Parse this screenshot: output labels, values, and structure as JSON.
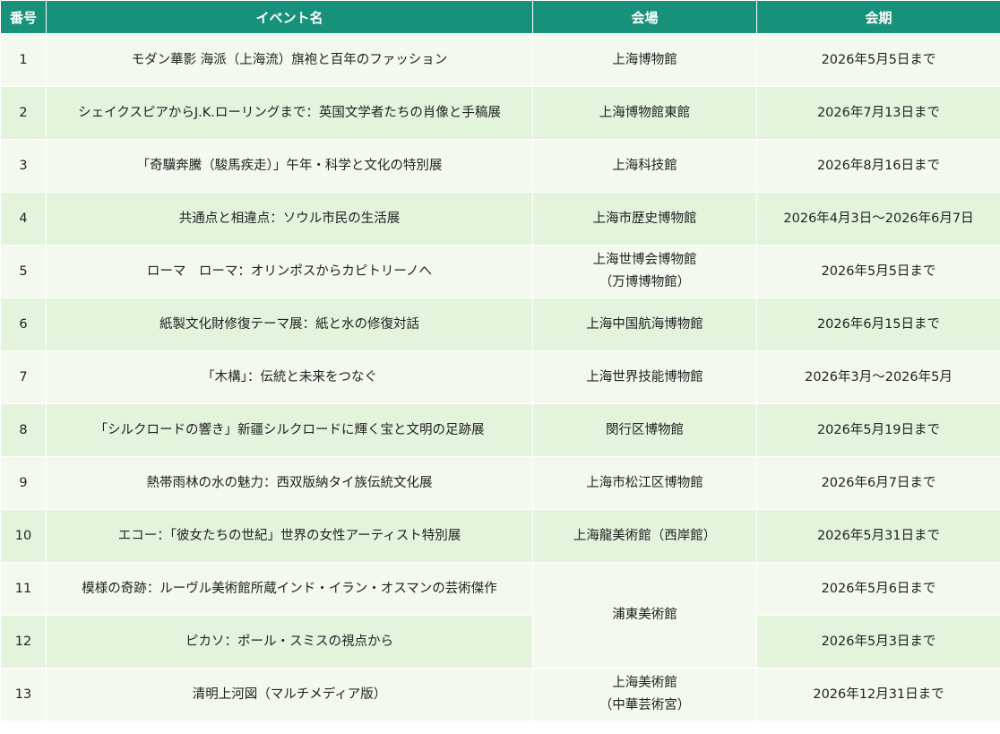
{
  "header": {
    "number": "番号",
    "event": "イベント名",
    "venue": "会場",
    "period": "会期"
  },
  "rows": [
    {
      "no": "1",
      "event": "モダン華影 海派（上海流）旗袍と百年のファッション",
      "venue_lines": [
        "上海博物館"
      ],
      "period": "2026年5月5日まで"
    },
    {
      "no": "2",
      "event": "シェイクスピアからJ.K.ローリングまで：英国文学者たちの肖像と手稿展",
      "venue_lines": [
        "上海博物館東館"
      ],
      "period": "2026年7月13日まで"
    },
    {
      "no": "3",
      "event": "「奇驥奔騰（駿馬疾走）」午年・科学と文化の特別展",
      "venue_lines": [
        "上海科技館"
      ],
      "period": "2026年8月16日まで"
    },
    {
      "no": "4",
      "event": "共通点と相違点：ソウル市民の生活展",
      "venue_lines": [
        "上海市歴史博物館"
      ],
      "period": "2026年4月3日～2026年6月7日"
    },
    {
      "no": "5",
      "event": "ローマ　ローマ：オリンポスからカピトリーノへ",
      "venue_lines": [
        "上海世博会博物館",
        "（万博博物館）"
      ],
      "period": "2026年5月5日まで"
    },
    {
      "no": "6",
      "event": "紙製文化財修復テーマ展：紙と水の修復対話",
      "venue_lines": [
        "上海中国航海博物館"
      ],
      "period": "2026年6月15日まで"
    },
    {
      "no": "7",
      "event": "「木構」：伝統と未来をつなぐ",
      "venue_lines": [
        "上海世界技能博物館"
      ],
      "period": "2026年3月～2026年5月"
    },
    {
      "no": "8",
      "event": "「シルクロードの響き」新疆シルクロードに輝く宝と文明の足跡展",
      "venue_lines": [
        "閔行区博物館"
      ],
      "period": "2026年5月19日まで"
    },
    {
      "no": "9",
      "event": "熱帯雨林の水の魅力：西双版納タイ族伝統文化展",
      "venue_lines": [
        "上海市松江区博物館"
      ],
      "period": "2026年6月7日まで"
    },
    {
      "no": "10",
      "event": "エコー：「彼女たちの世紀」世界の女性アーティスト特別展",
      "venue_lines": [
        "上海龍美術館（西岸館）"
      ],
      "period": "2026年5月31日まで"
    },
    {
      "no": "11",
      "event": "模様の奇跡：ルーヴル美術館所蔵インド・イラン・オスマンの芸術傑作",
      "venue_lines": [
        "浦東美術館"
      ],
      "venue_rowspan": 2,
      "period": "2026年5月6日まで"
    },
    {
      "no": "12",
      "event": "ピカソ：ポール・スミスの視点から",
      "venue_lines": [],
      "venue_skip": true,
      "period": "2026年5月3日まで"
    },
    {
      "no": "13",
      "event": "清明上河図（マルチメディア版）",
      "venue_lines": [
        "上海美術館",
        "（中華芸術宮）"
      ],
      "period": "2026年12月31日まで"
    }
  ]
}
